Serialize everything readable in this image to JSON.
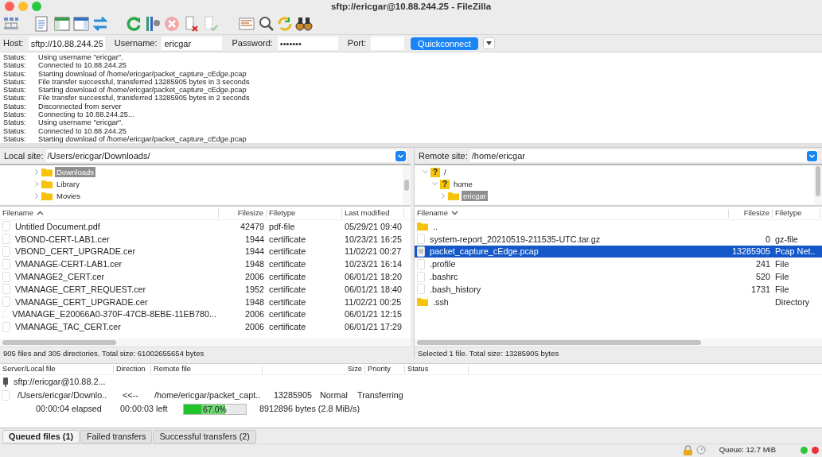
{
  "window": {
    "title": "sftp://ericgar@10.88.244.25 - FileZilla"
  },
  "quickconnect": {
    "host_label": "Host:",
    "host": "sftp://10.88.244.25",
    "username_label": "Username:",
    "username": "ericgar",
    "password_label": "Password:",
    "password": "•••••••",
    "port_label": "Port:",
    "button": "Quickconnect"
  },
  "log": [
    {
      "label": "Status:",
      "message": "Using username \"ericgar\"."
    },
    {
      "label": "Status:",
      "message": "Connected to 10.88.244.25"
    },
    {
      "label": "Status:",
      "message": "Starting download of /home/ericgar/packet_capture_cEdge.pcap"
    },
    {
      "label": "Status:",
      "message": "File transfer successful, transferred 13285905 bytes in 3 seconds"
    },
    {
      "label": "Status:",
      "message": "Starting download of /home/ericgar/packet_capture_cEdge.pcap"
    },
    {
      "label": "Status:",
      "message": "File transfer successful, transferred 13285905 bytes in 2 seconds"
    },
    {
      "label": "Status:",
      "message": "Disconnected from server"
    },
    {
      "label": "Status:",
      "message": "Connecting to 10.88.244.25..."
    },
    {
      "label": "Status:",
      "message": "Using username \"ericgar\"."
    },
    {
      "label": "Status:",
      "message": "Connected to 10.88.244.25"
    },
    {
      "label": "Status:",
      "message": "Starting download of /home/ericgar/packet_capture_cEdge.pcap"
    }
  ],
  "local": {
    "site_label": "Local site:",
    "path": "/Users/ericgar/Downloads/",
    "tree": [
      {
        "label": "Downloads",
        "kind": "folder",
        "expanded": false,
        "selected": true
      },
      {
        "label": "Library",
        "kind": "folder",
        "expanded": false,
        "selected": false
      },
      {
        "label": "Movies",
        "kind": "folder",
        "expanded": false,
        "selected": false
      }
    ],
    "columns": [
      {
        "label": "Filename",
        "sorted": true,
        "descending": false
      },
      {
        "label": "Filesize",
        "sorted": false
      },
      {
        "label": "Filetype",
        "sorted": false
      },
      {
        "label": "Last modified",
        "sorted": false
      }
    ],
    "rows": [
      {
        "kind": "file",
        "selected": false,
        "cells": [
          "Untitled Document.pdf",
          "42479",
          "pdf-file",
          "05/29/21 09:40"
        ]
      },
      {
        "kind": "file",
        "selected": false,
        "cells": [
          "VBOND-CERT-LAB1.cer",
          "1944",
          "certificate",
          "10/23/21 16:25"
        ]
      },
      {
        "kind": "file",
        "selected": false,
        "cells": [
          "VBOND_CERT_UPGRADE.cer",
          "1944",
          "certificate",
          "11/02/21 00:27"
        ]
      },
      {
        "kind": "file",
        "selected": false,
        "cells": [
          "VMANAGE-CERT-LAB1.cer",
          "1948",
          "certificate",
          "10/23/21 16:14"
        ]
      },
      {
        "kind": "file",
        "selected": false,
        "cells": [
          "VMANAGE2_CERT.cer",
          "2006",
          "certificate",
          "06/01/21 18:20"
        ]
      },
      {
        "kind": "file",
        "selected": false,
        "cells": [
          "VMANAGE_CERT_REQUEST.cer",
          "1952",
          "certificate",
          "06/01/21 18:40"
        ]
      },
      {
        "kind": "file",
        "selected": false,
        "cells": [
          "VMANAGE_CERT_UPGRADE.cer",
          "1948",
          "certificate",
          "11/02/21 00:25"
        ]
      },
      {
        "kind": "file",
        "selected": false,
        "cells": [
          "VMANAGE_E20066A0-370F-47CB-8EBE-11EB780...",
          "2006",
          "certificate",
          "06/01/21 12:15"
        ]
      },
      {
        "kind": "file",
        "selected": false,
        "cells": [
          "VMANAGE_TAC_CERT.cer",
          "2006",
          "certificate",
          "06/01/21 17:29"
        ]
      }
    ],
    "status": "905 files and 305 directories. Total size: 61002655654 bytes"
  },
  "remote": {
    "site_label": "Remote site:",
    "path": "/home/ericgar",
    "tree": [
      {
        "label": "/",
        "kind": "unknown",
        "badge": "?",
        "expanded": true,
        "selected": false,
        "children": [
          {
            "label": "home",
            "kind": "unknown",
            "badge": "?",
            "expanded": true,
            "selected": false,
            "children": [
              {
                "label": "ericgar",
                "kind": "folder",
                "expanded": false,
                "selected": true
              }
            ]
          }
        ]
      }
    ],
    "columns": [
      {
        "label": "Filename",
        "sorted": true,
        "descending": true
      },
      {
        "label": "Filesize",
        "sorted": false
      },
      {
        "label": "Filetype",
        "sorted": false
      }
    ],
    "rows": [
      {
        "kind": "folder",
        "selected": false,
        "cells": [
          "..",
          "",
          ""
        ]
      },
      {
        "kind": "file",
        "selected": false,
        "cells": [
          "system-report_20210519-211535-UTC.tar.gz",
          "0",
          "gz-file"
        ]
      },
      {
        "kind": "file",
        "selected": true,
        "cells": [
          "packet_capture_cEdge.pcap",
          "13285905",
          "Pcap Net.."
        ]
      },
      {
        "kind": "file",
        "selected": false,
        "cells": [
          ".profile",
          "241",
          "File"
        ]
      },
      {
        "kind": "file",
        "selected": false,
        "cells": [
          ".bashrc",
          "520",
          "File"
        ]
      },
      {
        "kind": "file",
        "selected": false,
        "cells": [
          ".bash_history",
          "1731",
          "File"
        ]
      },
      {
        "kind": "folder",
        "selected": false,
        "cells": [
          ".ssh",
          "",
          "Directory"
        ]
      }
    ],
    "status": "Selected 1 file. Total size: 13285905 bytes"
  },
  "queue": {
    "columns": [
      "Server/Local file",
      "Direction",
      "Remote file",
      "Size",
      "Priority",
      "Status"
    ],
    "server": "sftp://ericgar@10.88.2...",
    "transfer": {
      "local": "/Users/ericgar/Downlo..",
      "direction": "<<--",
      "remote": "/home/ericgar/packet_capt..",
      "size": "13285905",
      "priority": "Normal",
      "status": "Transferring"
    },
    "progress": {
      "elapsed": "00:00:04 elapsed",
      "left": "00:00:03 left",
      "level": 0.67,
      "label": "67.0%",
      "bytes": "8912896 bytes (2.8 MiB/s)"
    }
  },
  "tabs": [
    {
      "label": "Queued files (1)",
      "selected": true
    },
    {
      "label": "Failed transfers",
      "selected": false
    },
    {
      "label": "Successful transfers (2)",
      "selected": false
    }
  ],
  "status_bar": {
    "queue": "Queue: 12.7 MiB"
  }
}
